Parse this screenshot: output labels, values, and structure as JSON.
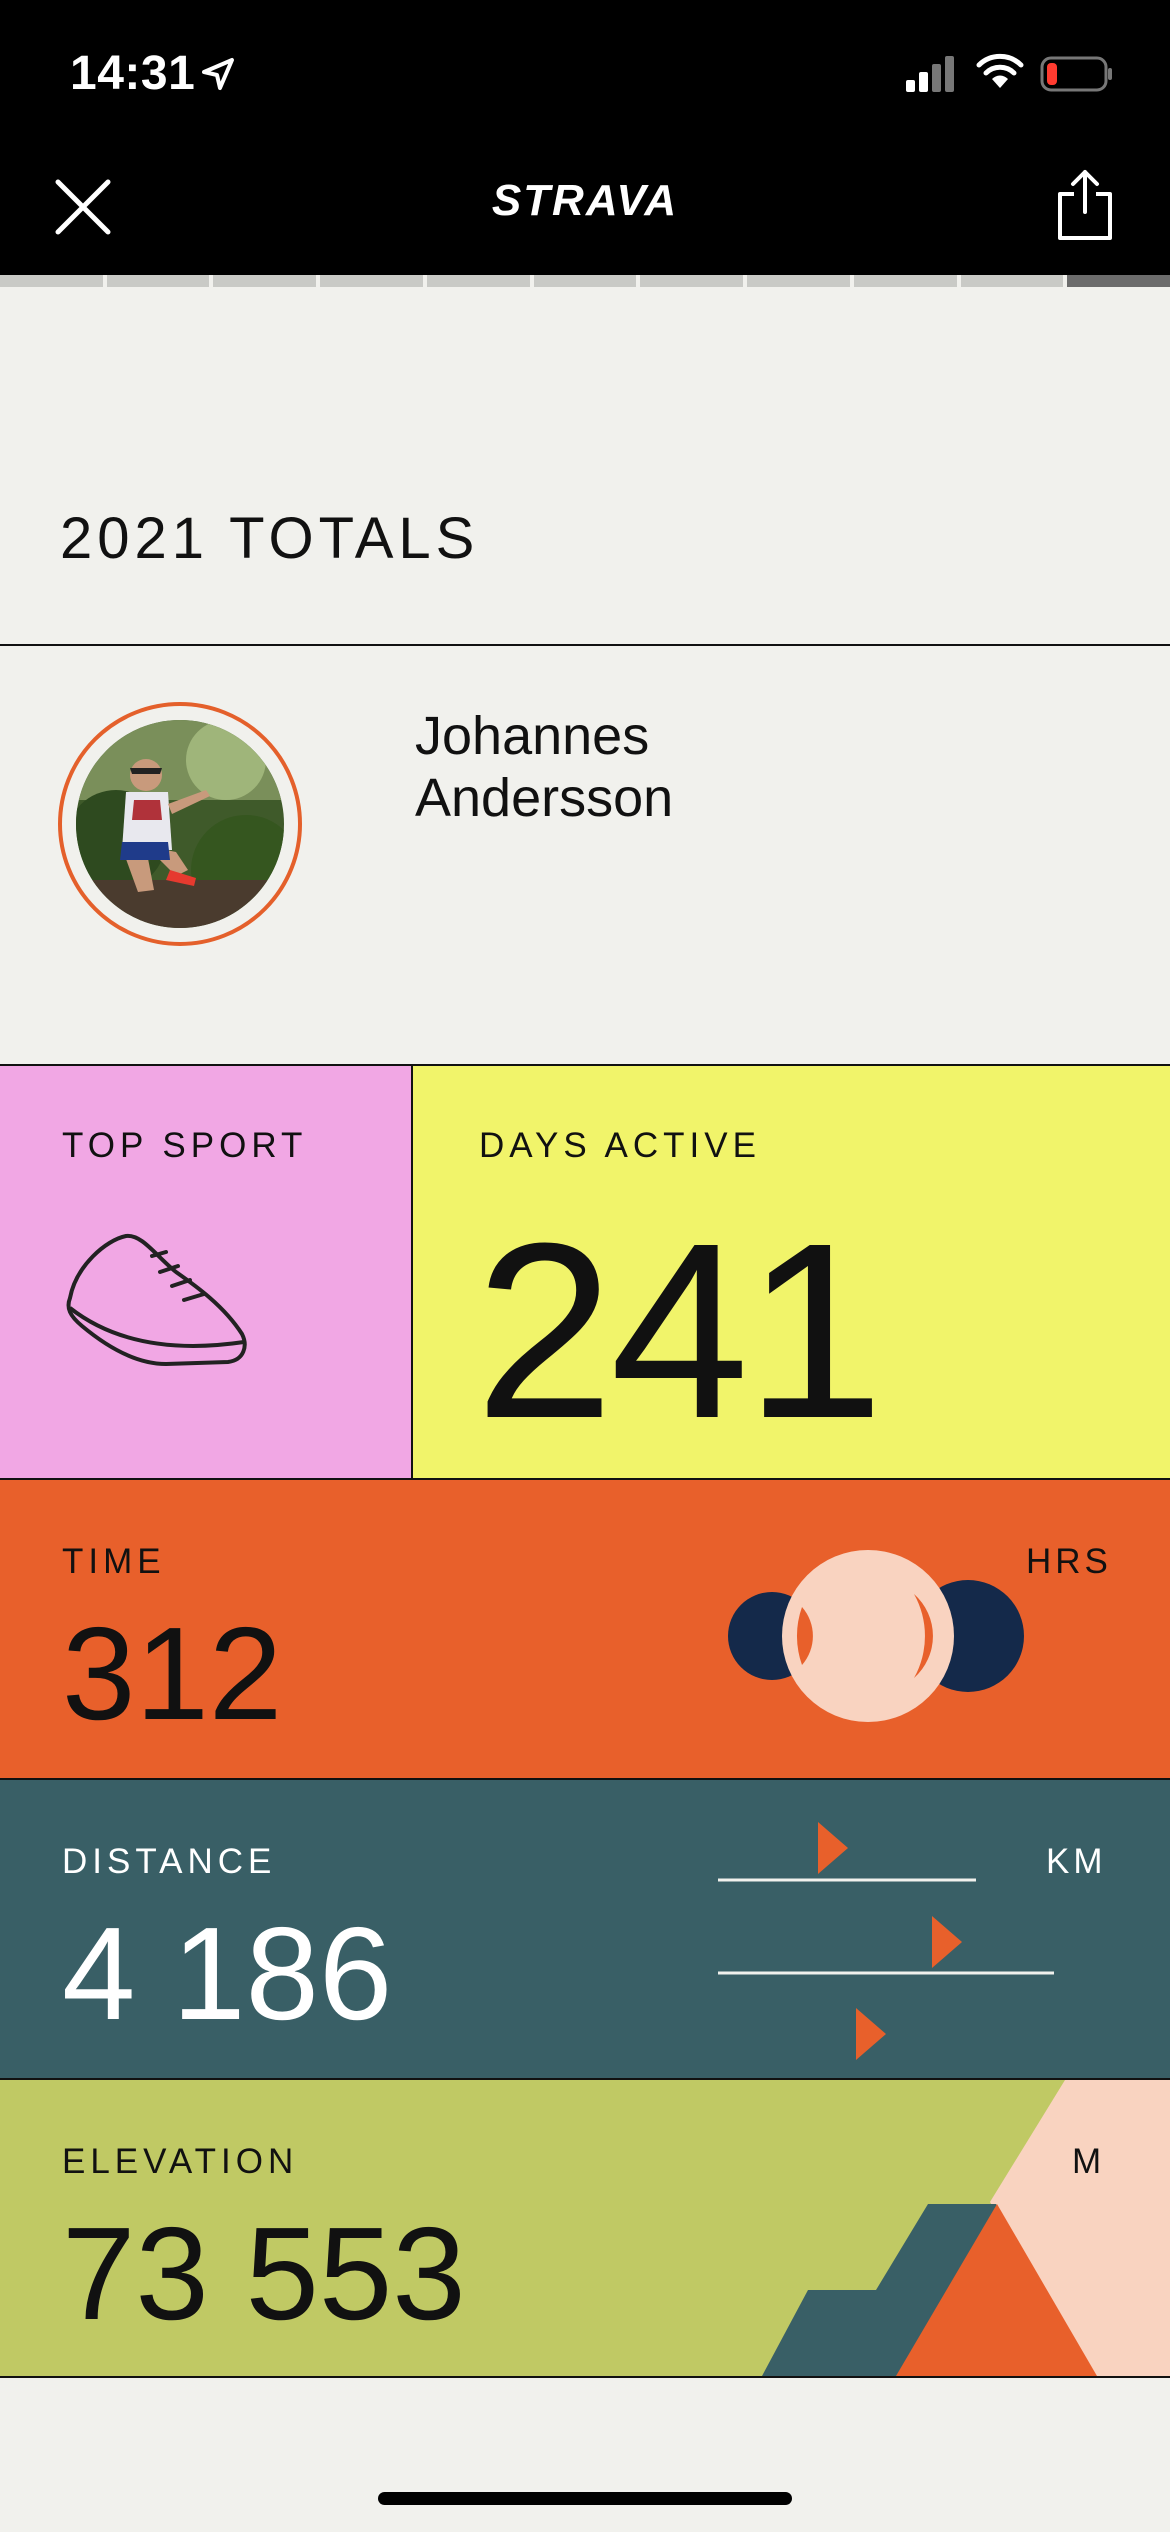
{
  "status_bar": {
    "time": "14:31"
  },
  "nav": {
    "logo": "STRAVA"
  },
  "story_progress": {
    "segments": 11,
    "active_index": 10
  },
  "page": {
    "title": "2021 TOTALS"
  },
  "athlete": {
    "name_first": "Johannes",
    "name_last": "Andersson"
  },
  "stats": {
    "top_sport": {
      "label": "TOP SPORT",
      "icon": "running-shoe-icon"
    },
    "days_active": {
      "label": "DAYS ACTIVE",
      "value": "241"
    },
    "time": {
      "label": "TIME",
      "value": "312",
      "unit": "HRS"
    },
    "distance": {
      "label": "DISTANCE",
      "value": "4 186",
      "unit": "KM"
    },
    "elevation": {
      "label": "ELEVATION",
      "value": "73 553",
      "unit": "M"
    }
  },
  "colors": {
    "accent": "#e4602b",
    "top_sport_bg": "#f1a7e4",
    "days_active_bg": "#f1f46a",
    "time_bg": "#e8602b",
    "distance_bg": "#395f66",
    "elevation_bg": "#c0c964",
    "peach": "#f9d3c0",
    "navy": "#14294a"
  }
}
